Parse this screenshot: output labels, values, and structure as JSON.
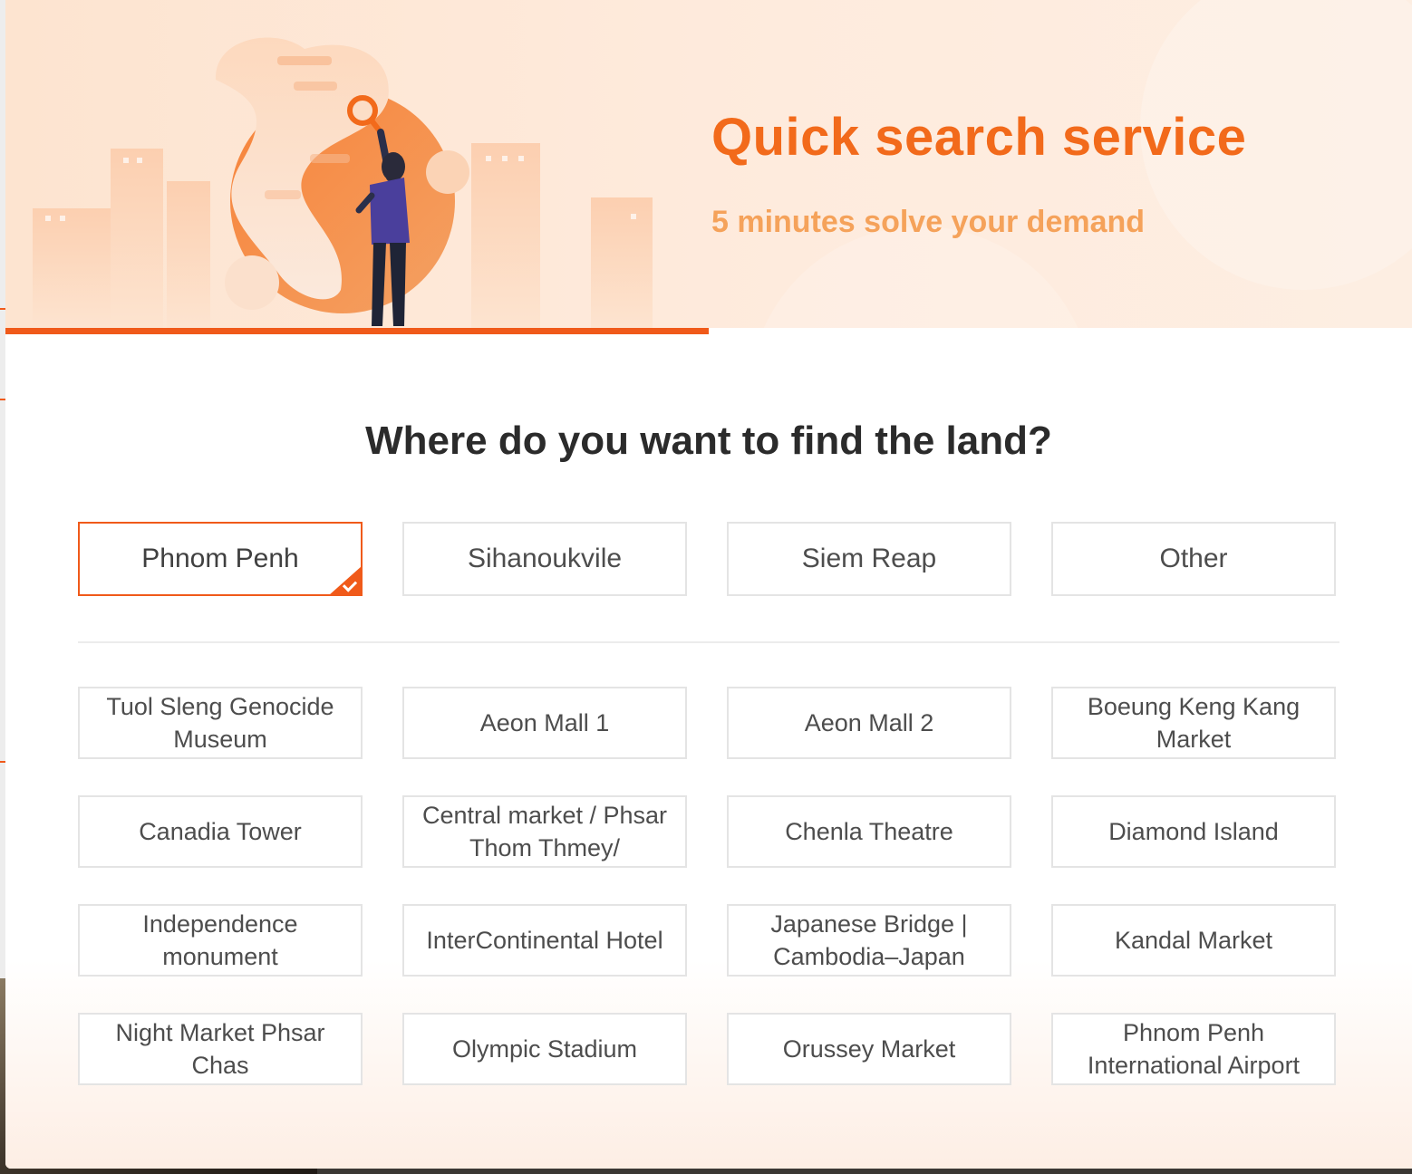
{
  "banner": {
    "title": "Quick search service",
    "subtitle": "5 minutes solve your demand",
    "step_progress": 0.5
  },
  "question": "Where do you want to find the land?",
  "cities": [
    {
      "label": "Phnom Penh",
      "selected": true
    },
    {
      "label": "Sihanoukvile",
      "selected": false
    },
    {
      "label": "Siem Reap",
      "selected": false
    },
    {
      "label": "Other",
      "selected": false
    }
  ],
  "places": [
    "Tuol Sleng Genocide Museum",
    "Aeon Mall 1",
    "Aeon Mall 2",
    "Boeung Keng Kang Market",
    "Canadia Tower",
    "Central market / Phsar Thom Thmey/",
    "Chenla Theatre",
    "Diamond Island",
    "Independence monument",
    "InterContinental Hotel",
    "Japanese Bridge | Cambodia–Japan",
    "Kandal Market",
    "Night Market Phsar Chas",
    "Olympic Stadium",
    "Orussey Market",
    "Phnom Penh International Airport"
  ],
  "colors": {
    "accent": "#f05a1a",
    "title": "#f26a1b",
    "subtitle": "#f5a25a",
    "banner_bg": "#fde4d0"
  },
  "icons": {
    "selected": "check-icon",
    "illustration": "search-illustration"
  }
}
